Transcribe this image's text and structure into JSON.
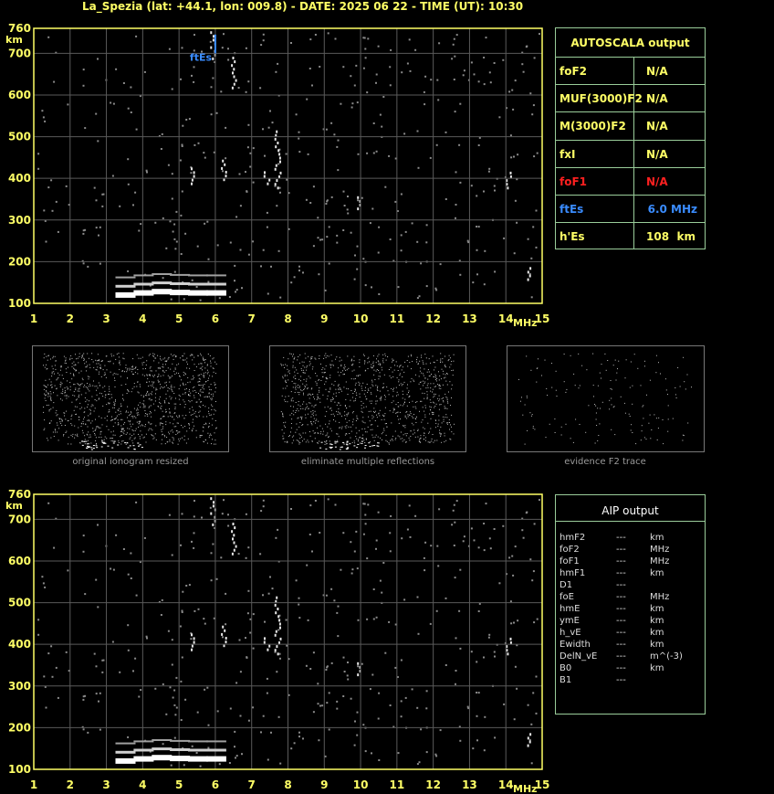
{
  "title": "La_Spezia (lat: +44.1, lon: 009.8) - DATE: 2025 06 22 - TIME (UT): 10:30",
  "ionogram_top": {
    "y_unit": "km",
    "x_unit": "MHz",
    "y_ticks": [
      "760",
      "700",
      "600",
      "500",
      "400",
      "300",
      "200",
      "100"
    ],
    "x_ticks": [
      "1",
      "2",
      "3",
      "4",
      "5",
      "6",
      "7",
      "8",
      "9",
      "10",
      "11",
      "12",
      "13",
      "14",
      "15"
    ],
    "trace_label": "ftEs"
  },
  "ionogram_bottom": {
    "y_unit": "km",
    "x_unit": "MHz",
    "y_ticks": [
      "760",
      "700",
      "600",
      "500",
      "400",
      "300",
      "200",
      "100"
    ],
    "x_ticks": [
      "1",
      "2",
      "3",
      "4",
      "5",
      "6",
      "7",
      "8",
      "9",
      "10",
      "11",
      "12",
      "13",
      "14",
      "15"
    ]
  },
  "autoscala": {
    "title": "AUTOSCALA output",
    "rows": [
      {
        "name": "foF2",
        "value": "N/A",
        "unit": ""
      },
      {
        "name": "MUF(3000)F2",
        "value": "N/A",
        "unit": ""
      },
      {
        "name": "M(3000)F2",
        "value": "N/A",
        "unit": ""
      },
      {
        "name": "fxI",
        "value": "N/A",
        "unit": ""
      },
      {
        "name": "foF1",
        "value": "N/A",
        "unit": ""
      },
      {
        "name": "ftEs",
        "value": "6.0 MHz",
        "unit": ""
      },
      {
        "name": "h'Es",
        "value": "108",
        "unit": "km"
      }
    ],
    "colors": {
      "default": "#ffff66",
      "foF1": "#ff2020",
      "ftEs": "#3a8cff"
    }
  },
  "thumbnails": [
    {
      "caption": "original ionogram resized"
    },
    {
      "caption": "eliminate multiple reflections"
    },
    {
      "caption": "evidence F2 trace"
    }
  ],
  "aip": {
    "title": "AIP output",
    "rows": [
      {
        "name": "hmF2",
        "value": "---",
        "unit": "km"
      },
      {
        "name": "foF2",
        "value": "---",
        "unit": "MHz"
      },
      {
        "name": "foF1",
        "value": "---",
        "unit": "MHz"
      },
      {
        "name": "hmF1",
        "value": "---",
        "unit": "km"
      },
      {
        "name": "D1",
        "value": "---",
        "unit": ""
      },
      {
        "name": "foE",
        "value": "---",
        "unit": "MHz"
      },
      {
        "name": "hmE",
        "value": "---",
        "unit": "km"
      },
      {
        "name": "ymE",
        "value": "---",
        "unit": "km"
      },
      {
        "name": "h_vE",
        "value": "---",
        "unit": "km"
      },
      {
        "name": "Ewidth",
        "value": "---",
        "unit": "km"
      },
      {
        "name": "DelN_vE",
        "value": "---",
        "unit": "m^(-3)"
      },
      {
        "name": "B0",
        "value": "---",
        "unit": "km"
      },
      {
        "name": "B1",
        "value": "---",
        "unit": ""
      }
    ]
  },
  "chart_data": [
    {
      "type": "scatter",
      "title": "",
      "xlabel": "MHz",
      "ylabel": "km",
      "xlim": [
        1,
        15
      ],
      "ylim": [
        100,
        760
      ],
      "grid": true,
      "series": [
        {
          "name": "",
          "x": [
            3.5,
            4.0,
            4.5,
            5.0,
            5.5,
            6.0
          ],
          "y": [
            120,
            125,
            128,
            126,
            125,
            125
          ]
        }
      ],
      "annotations": [
        {
          "text": "ftEs",
          "x": 6.0,
          "y": 730
        }
      ]
    },
    {
      "type": "scatter",
      "title": "",
      "xlabel": "MHz",
      "ylabel": "km",
      "xlim": [
        1,
        15
      ],
      "ylim": [
        100,
        760
      ],
      "grid": true,
      "series": [
        {
          "name": "",
          "x": [
            3.5,
            4.0,
            4.5,
            5.0,
            5.5,
            6.0
          ],
          "y": [
            120,
            125,
            128,
            126,
            125,
            125
          ]
        }
      ]
    }
  ]
}
